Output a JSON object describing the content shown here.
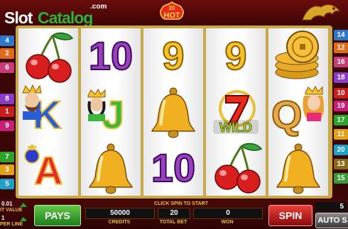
{
  "logo": {
    "slot": "Slot",
    "catalog": "Catalog",
    "com": ".com"
  },
  "game_logo": {
    "text": "HOT",
    "number": "20"
  },
  "paylines_left": [
    {
      "num": "4",
      "color": "#2d78c8"
    },
    {
      "num": "2",
      "color": "#e06a1a"
    },
    {
      "num": "6",
      "color": "#c83c7a"
    },
    {
      "num": "8",
      "color": "#8a3cc8"
    },
    {
      "num": "1",
      "color": "#c81e1e"
    },
    {
      "num": "9",
      "color": "#c81e78"
    },
    {
      "num": "7",
      "color": "#2aa52a"
    },
    {
      "num": "3",
      "color": "#e0a01a"
    },
    {
      "num": "5",
      "color": "#1ea0c8"
    }
  ],
  "paylines_right": [
    {
      "num": "14",
      "color": "#2d78c8"
    },
    {
      "num": "12",
      "color": "#e06a1a"
    },
    {
      "num": "16",
      "color": "#c83c7a"
    },
    {
      "num": "18",
      "color": "#8a3cc8"
    },
    {
      "num": "10",
      "color": "#c81e1e"
    },
    {
      "num": "19",
      "color": "#c81e78"
    },
    {
      "num": "17",
      "color": "#2aa52a"
    },
    {
      "num": "11",
      "color": "#e0a01a"
    },
    {
      "num": "20",
      "color": "#1ea0c8"
    },
    {
      "num": "13",
      "color": "#8a6a1a"
    },
    {
      "num": "15",
      "color": "#3a9a3a"
    }
  ],
  "reels": [
    [
      "cherry",
      "K",
      "A"
    ],
    [
      "10",
      "J",
      "bell"
    ],
    [
      "9",
      "bell",
      "10"
    ],
    [
      "9",
      "seven-wild",
      "cherry"
    ],
    [
      "coins",
      "Q",
      "bell"
    ]
  ],
  "wild_label": "WILD",
  "bottom": {
    "click_hint": "CLICK SPIN TO START",
    "pays": "PAYS",
    "credits_value": "50000",
    "credits_label": "CREDITS",
    "total_bet_value": "20",
    "total_bet_label": "TOTAL BET",
    "won_value": "0",
    "won_label": "WON",
    "spin": "SPIN",
    "auto_spin": "AUTO S",
    "lines_value": "5",
    "unit_value": "0.01",
    "unit_label": "IT VALUE",
    "bet_per_line": "1",
    "bet_per_line_label": "PER LINE"
  },
  "colors": {
    "gold": "#f4c12a",
    "purple": "#9b3fc0",
    "red": "#d81e1e",
    "green": "#2db13a"
  }
}
